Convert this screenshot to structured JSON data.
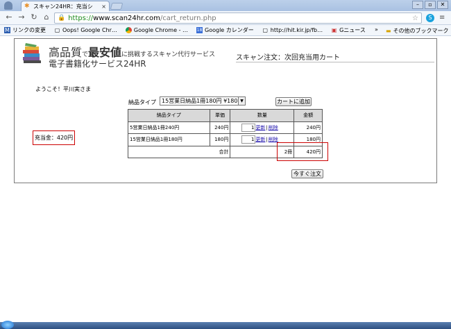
{
  "browser": {
    "tab_title": "スキャン24HR：充当シ",
    "tab_close": "×",
    "url_scheme": "https://",
    "url_host": "www.scan24hr.com",
    "url_path": "/cart_return.php",
    "skype_label": "S"
  },
  "bookmarks": {
    "items": [
      {
        "icon": "M",
        "label": "リンクの変更"
      },
      {
        "icon": "▢",
        "label": "Oops! Google Chr…"
      },
      {
        "icon": "▢",
        "label": "Google Chrome - …"
      },
      {
        "icon": "18",
        "label": "Google カレンダー"
      },
      {
        "icon": "▢",
        "label": "http://hit.kir.jp/fb…"
      },
      {
        "icon": "▣",
        "label": "Gニュース"
      }
    ],
    "more": "»",
    "other_label": "その他のブックマーク"
  },
  "site": {
    "tagline_part1": "高品質",
    "tagline_part2": "で",
    "tagline_part3": "最安値",
    "tagline_part4": "に挑戦するスキャン代行サービス",
    "service_name": "電子書籍化サービス24HR",
    "page_heading": "スキャン注文：次回充当用カート",
    "welcome": "ようこそ！平川実さま",
    "credit": "充当金：420円"
  },
  "form": {
    "type_label": "納品タイプ",
    "type_selected": "15営業日納品1冊180円 ¥180",
    "add_cart": "カートに追加",
    "order_now": "今すぐ注文"
  },
  "cart": {
    "headers": [
      "納品タイプ",
      "単価",
      "数量",
      "金額"
    ],
    "rows": [
      {
        "name": "5営業日納品1冊240円",
        "price": "240円",
        "qty": "1",
        "update": "更新",
        "sep": "|",
        "delete": "削除",
        "amount": "240円"
      },
      {
        "name": "15営業日納品1冊180円",
        "price": "180円",
        "qty": "1",
        "update": "更新",
        "sep": "|",
        "delete": "削除",
        "amount": "180円"
      }
    ],
    "total_label": "合計",
    "total_qty": "2冊",
    "total_amount": "420円"
  },
  "colors": {
    "highlight_border": "#cc0000",
    "link": "#1a0dab"
  }
}
